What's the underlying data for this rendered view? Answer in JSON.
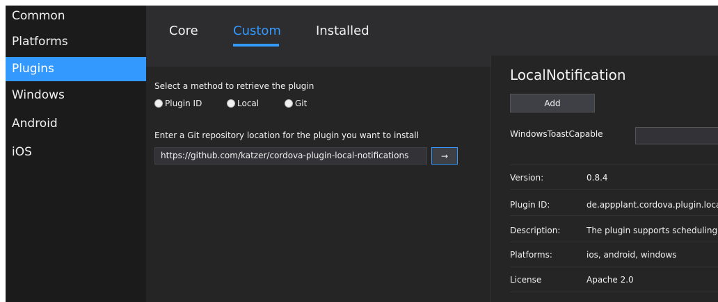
{
  "sidebar": {
    "items": [
      {
        "label": "Common"
      },
      {
        "label": "Platforms"
      },
      {
        "label": "Plugins"
      },
      {
        "label": "Windows"
      },
      {
        "label": "Android"
      },
      {
        "label": "iOS"
      }
    ],
    "active": "Plugins"
  },
  "tabs": [
    {
      "label": "Core"
    },
    {
      "label": "Custom"
    },
    {
      "label": "Installed"
    }
  ],
  "active_tab": "Custom",
  "retrieve": {
    "prompt": "Select a method to retrieve the plugin",
    "options": [
      {
        "label": "Plugin ID"
      },
      {
        "label": "Local"
      },
      {
        "label": "Git"
      }
    ],
    "git_prompt": "Enter a Git repository location for the plugin you want to install",
    "git_url": "https://github.com/katzer/cordova-plugin-local-notifications",
    "go_label": "→"
  },
  "plugin": {
    "name": "LocalNotification",
    "add_label": "Add",
    "variable_label": "WindowsToastCapable",
    "variable_value": "",
    "info": [
      {
        "key": "Version:",
        "value": "0.8.4"
      },
      {
        "key": "Plugin ID:",
        "value": "de.appplant.cordova.plugin.loca"
      },
      {
        "key": "Description:",
        "value": "The plugin supports scheduling lo"
      },
      {
        "key": "Platforms:",
        "value": "ios, android, windows"
      },
      {
        "key": "License",
        "value": "Apache 2.0"
      }
    ]
  },
  "colors": {
    "accent": "#3399ff",
    "background": "#252526",
    "sidebar": "#1b1b1c",
    "text": "#f1f1f1"
  }
}
